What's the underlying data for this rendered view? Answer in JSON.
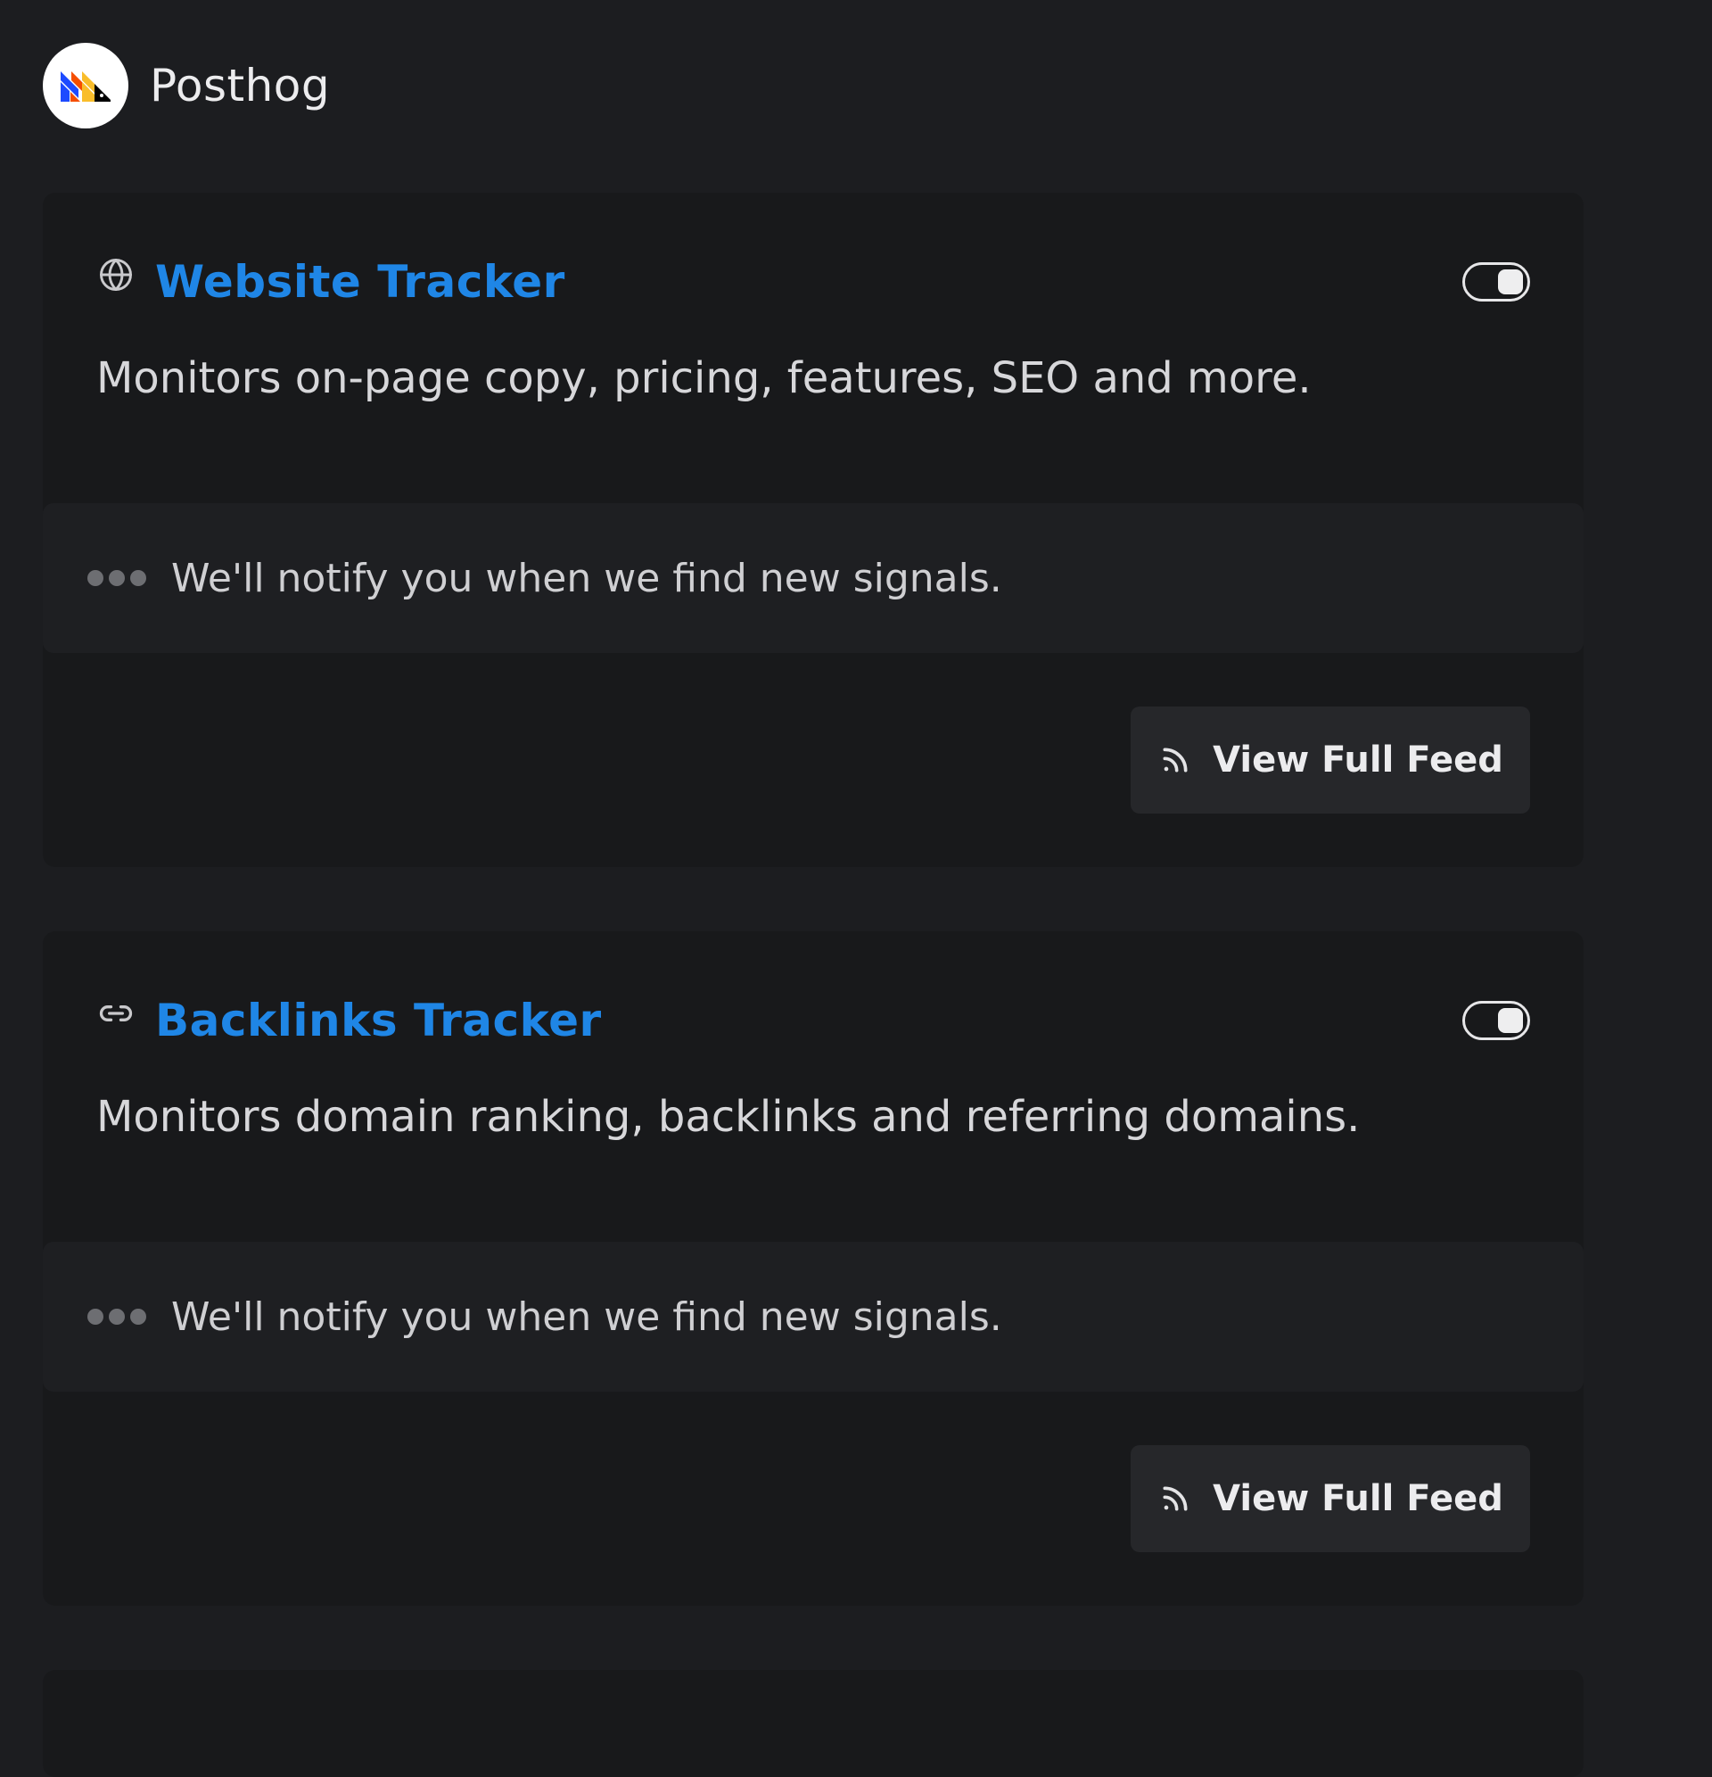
{
  "header": {
    "brand": "Posthog"
  },
  "trackers": [
    {
      "icon": "globe-icon",
      "title": "Website Tracker",
      "description": "Monitors on-page copy, pricing, features, SEO and more.",
      "enabled": true,
      "signal_text": "We'll notify you when we find new signals.",
      "button_label": "View Full Feed"
    },
    {
      "icon": "link-icon",
      "title": "Backlinks Tracker",
      "description": "Monitors domain ranking, backlinks and referring domains.",
      "enabled": true,
      "signal_text": "We'll notify you when we find new signals.",
      "button_label": "View Full Feed"
    }
  ],
  "colors": {
    "accent": "#1f86e6",
    "background": "#1c1d20",
    "card": "#18191b"
  }
}
